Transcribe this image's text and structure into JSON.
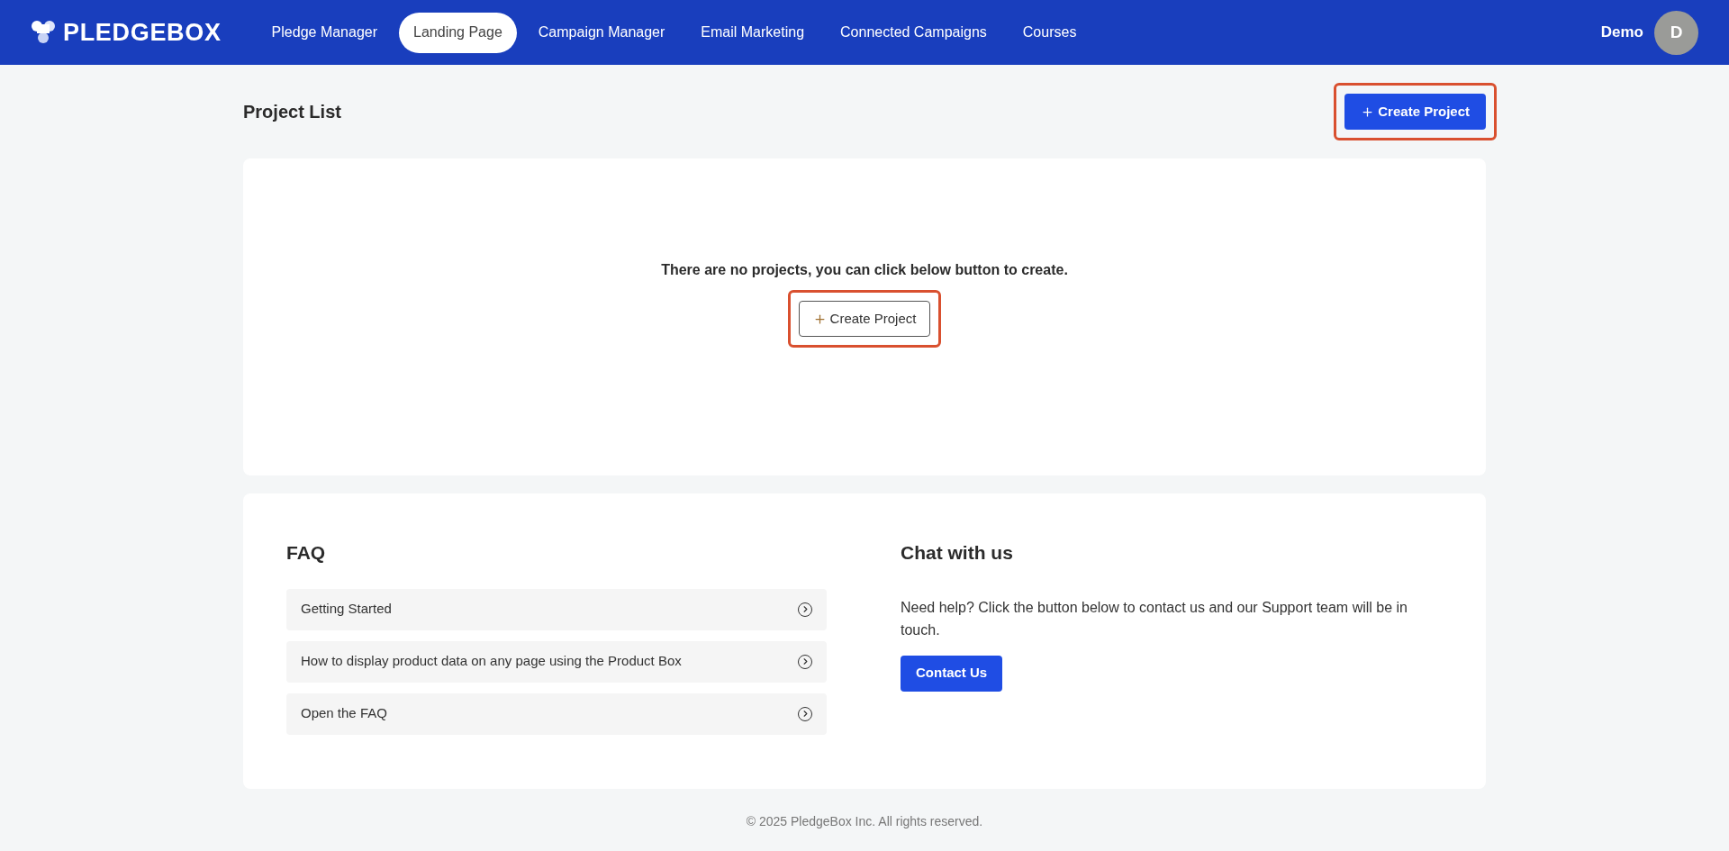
{
  "header": {
    "logo": "PLEDGEBOX",
    "nav": [
      {
        "label": "Pledge Manager",
        "selected": false
      },
      {
        "label": "Landing Page",
        "selected": true
      },
      {
        "label": "Campaign Manager",
        "selected": false
      },
      {
        "label": "Email Marketing",
        "selected": false
      },
      {
        "label": "Connected Campaigns",
        "selected": false
      },
      {
        "label": "Courses",
        "selected": false
      }
    ],
    "user": {
      "name": "Demo",
      "initial": "D"
    }
  },
  "projects": {
    "title": "Project List",
    "create_button": {
      "label": "Create Project",
      "highlighted": true
    },
    "empty_message": "There are no projects, you can click below button to create.",
    "empty_button": {
      "label": "Create Project",
      "highlighted": true
    }
  },
  "faq": {
    "title": "FAQ",
    "items": [
      "Getting Started",
      "How to display product data on any page using the Product Box",
      "Open the FAQ"
    ]
  },
  "chat": {
    "title": "Chat with us",
    "text": "Need help? Click the button below to contact us and our Support team will be in touch.",
    "button": "Contact Us"
  },
  "footer": "© 2025 PledgeBox Inc. All rights reserved."
}
